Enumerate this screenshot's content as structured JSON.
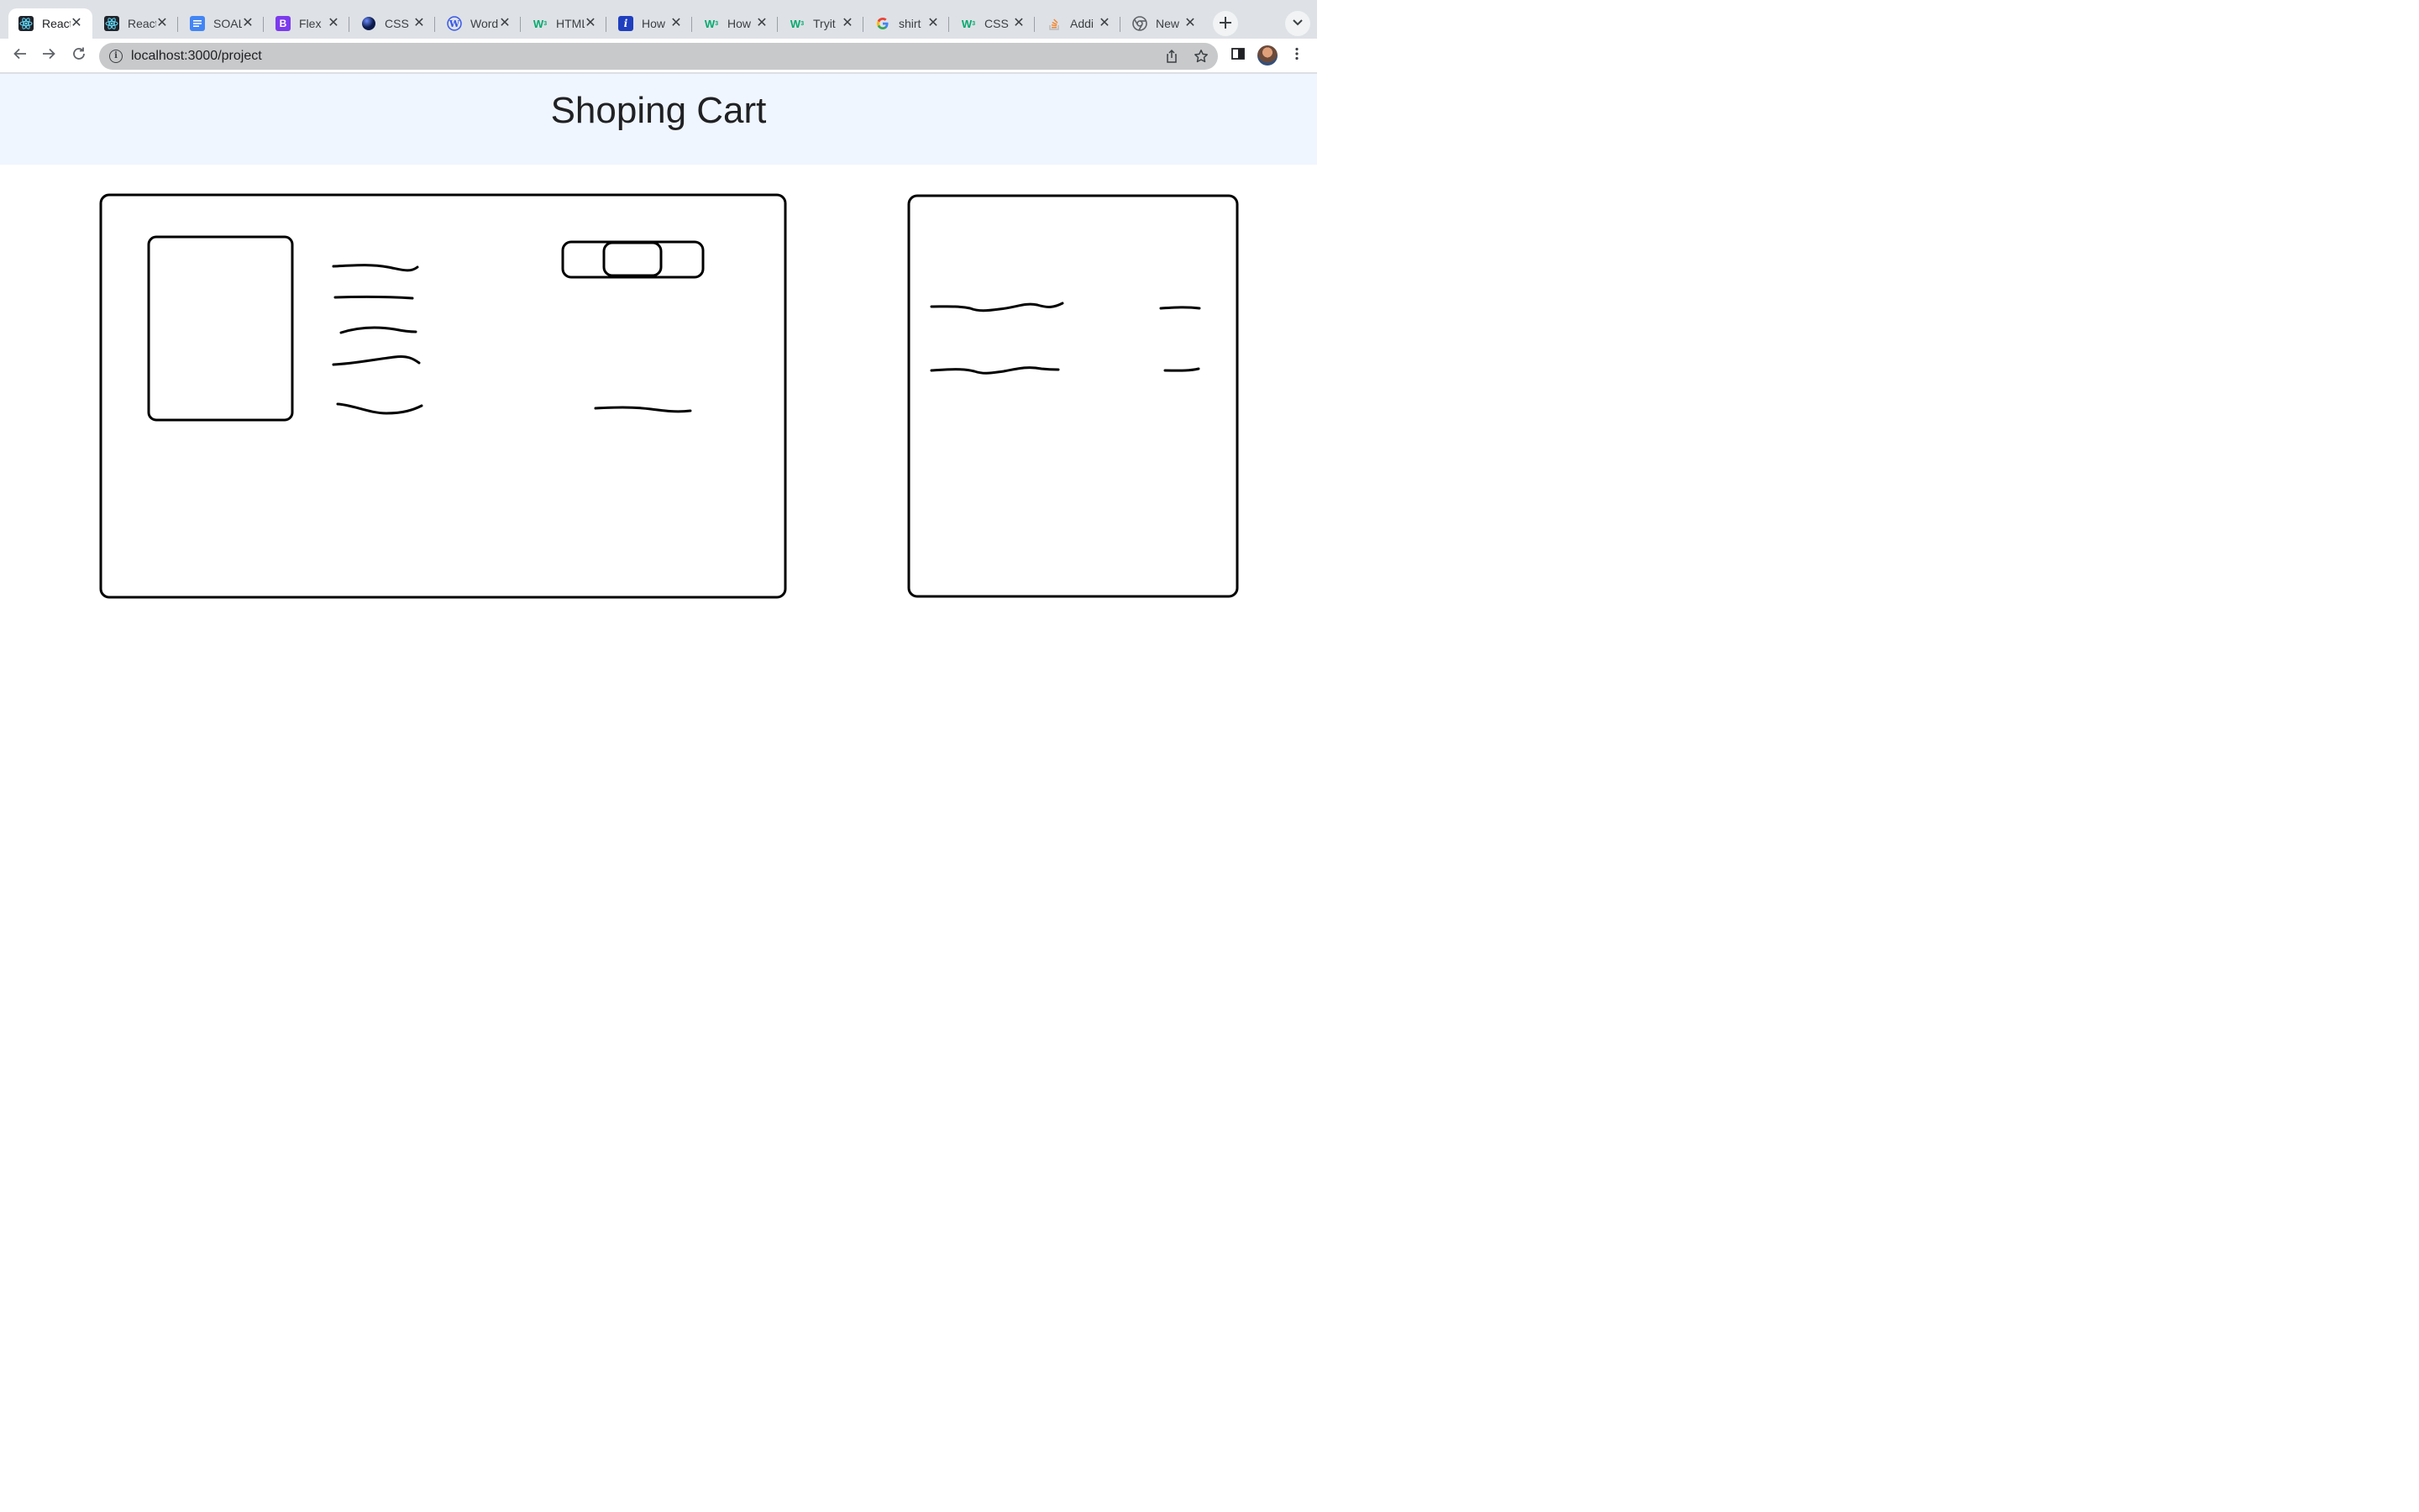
{
  "browser": {
    "tabs": [
      {
        "label": "React",
        "favicon": "react-icon",
        "active": true
      },
      {
        "label": "React",
        "favicon": "react-icon",
        "active": false
      },
      {
        "label": "SOAL",
        "favicon": "docs-icon",
        "active": false
      },
      {
        "label": "Flex",
        "favicon": "bootstrap-icon",
        "active": false
      },
      {
        "label": "CSS",
        "favicon": "globe-icon",
        "active": false
      },
      {
        "label": "Word",
        "favicon": "wordpress-icon",
        "active": false
      },
      {
        "label": "HTML",
        "favicon": "w3schools-icon",
        "active": false
      },
      {
        "label": "How",
        "favicon": "info-icon",
        "active": false
      },
      {
        "label": "How",
        "favicon": "w3schools-icon",
        "active": false
      },
      {
        "label": "Tryit",
        "favicon": "w3schools-icon",
        "active": false
      },
      {
        "label": "shirt",
        "favicon": "google-icon",
        "active": false
      },
      {
        "label": "CSS",
        "favicon": "w3schools-icon",
        "active": false
      },
      {
        "label": "Addi",
        "favicon": "stackoverflow-icon",
        "active": false
      },
      {
        "label": "New",
        "favicon": "chrome-icon",
        "active": false
      }
    ],
    "url": "localhost:3000/project"
  },
  "page": {
    "title": "Shoping Cart"
  }
}
